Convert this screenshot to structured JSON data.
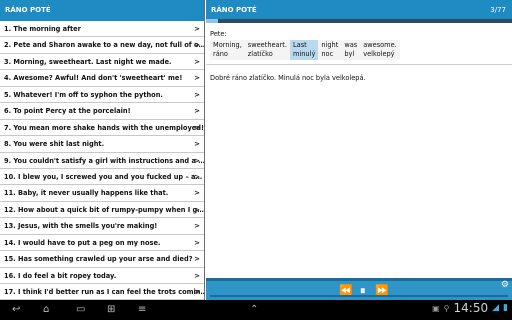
{
  "left_panel": {
    "header": "RÁNO POTÉ",
    "items": [
      "1. The morning after",
      "2. Pete and Sharon awake to a new day, not full of o…",
      "3. Morning, sweetheart. Last night we made.",
      "4. Awesome? Awful! And don't 'sweetheart' me!",
      "5. Whatever! I'm off to syphon the python.",
      "6. To point Percy at the porcelain!",
      "7. You mean more shake hands with the unemployed!",
      "8. You were shit last night.",
      "9. You couldn't satisfy a girl with instructions and a …",
      "10. I blew you, I screwed you and you fucked up – a…",
      "11. Baby, it never usually happens like that.",
      "12. How about a quick bit of rumpy-pumpy when I g…",
      "13. Jesus, with the smells you're making!",
      "14. I would have to put a peg on my nose.",
      "15. Has something crawled up your arse and died?",
      "16. I do feel a bit ropey today.",
      "17. I think I'd better run as I can feel the trots comin…"
    ],
    "chevron": ">"
  },
  "right_panel": {
    "title": "RÁNO POTÉ",
    "counter": "3/77",
    "progress_fraction": 0.039,
    "speaker": "Pete:",
    "glosses": [
      {
        "en": "Morning,",
        "cz": "ráno",
        "highlight": false
      },
      {
        "en": "sweetheart.",
        "cz": "zlatíčko",
        "highlight": false
      },
      {
        "en": "Last",
        "cz": "minulý",
        "highlight": true
      },
      {
        "en": "night",
        "cz": "noc",
        "highlight": false
      },
      {
        "en": "was",
        "cz": "byl",
        "highlight": false
      },
      {
        "en": "awesome.",
        "cz": "velkolepý",
        "highlight": false
      }
    ],
    "translation": "Dobré ráno zlatíčko. Minulá noc byla velkolepá."
  },
  "controls": {
    "rewind_icon": "⏪",
    "pause_icon": "⏸",
    "forward_icon": "⏩",
    "settings_icon": "⚙"
  },
  "system_bar": {
    "time": "14:50",
    "nav_icons": [
      "back-icon",
      "home-icon",
      "recent-apps-icon",
      "screenshot-icon",
      "menu-icon",
      "up-arrow-icon"
    ]
  },
  "colors": {
    "header_blue": "#1e8bc3",
    "control_blue": "#2f95c9",
    "highlight": "#b9d9ee"
  }
}
